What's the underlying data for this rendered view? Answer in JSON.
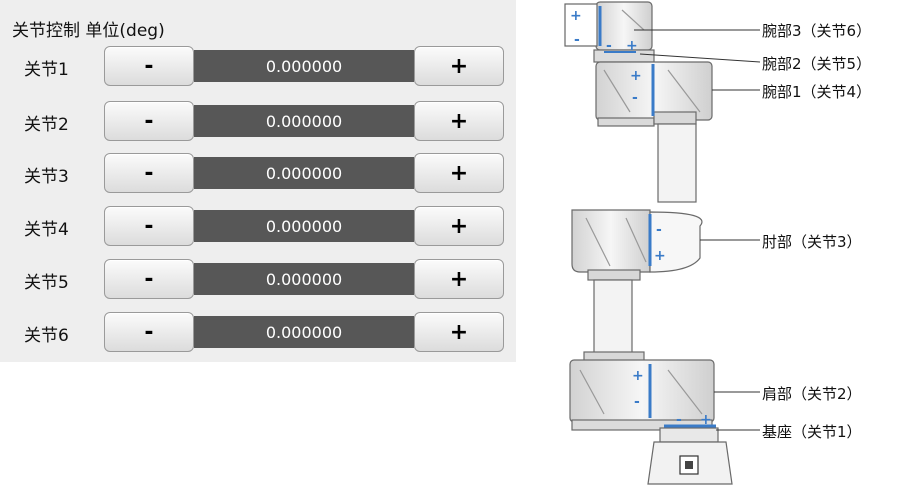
{
  "panel": {
    "title": "关节控制 单位(deg)",
    "minus_label": "-",
    "plus_label": "+",
    "joints": [
      {
        "label": "关节1",
        "value": "0.000000"
      },
      {
        "label": "关节2",
        "value": "0.000000"
      },
      {
        "label": "关节3",
        "value": "0.000000"
      },
      {
        "label": "关节4",
        "value": "0.000000"
      },
      {
        "label": "关节5",
        "value": "0.000000"
      },
      {
        "label": "关节6",
        "value": "0.000000"
      }
    ]
  },
  "diagram": {
    "callouts": [
      {
        "label": "腕部3（关节6）"
      },
      {
        "label": "腕部2（关节5）"
      },
      {
        "label": "腕部1（关节4）"
      },
      {
        "label": "肘部（关节3）"
      },
      {
        "label": "肩部（关节2）"
      },
      {
        "label": "基座（关节1）"
      }
    ],
    "marker_plus": "+",
    "marker_minus": "-",
    "accent_color": "#3a7bc8"
  }
}
